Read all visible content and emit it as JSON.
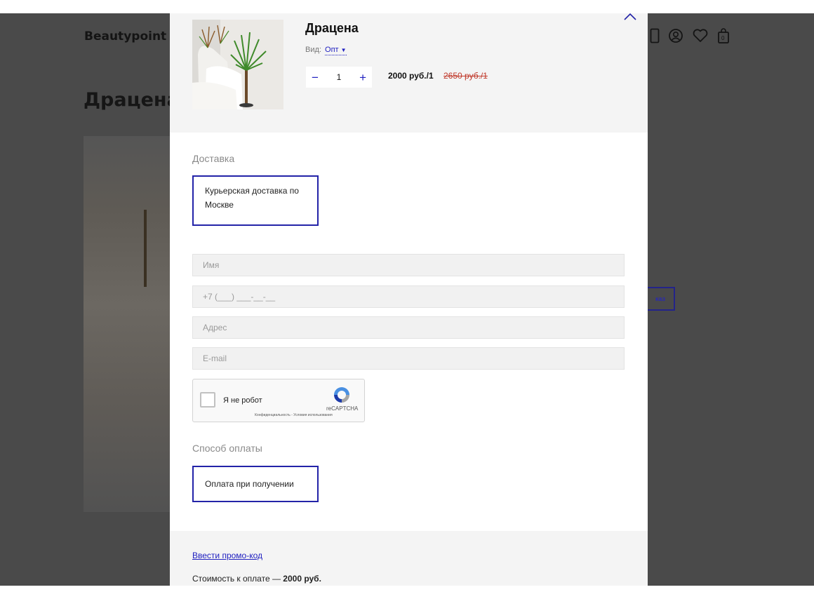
{
  "background": {
    "logo": "Beautypoint",
    "product_title": "Драцена",
    "order_button_fragment": "каз"
  },
  "modal": {
    "product": {
      "title": "Драцена",
      "variant_label": "Вид:",
      "variant_value": "Опт",
      "quantity": "1",
      "price": "2000 руб./1",
      "old_price": "2650 руб./1"
    },
    "delivery": {
      "label": "Доставка",
      "option": "Курьерская доставка по Москве"
    },
    "form": {
      "name_placeholder": "Имя",
      "phone_placeholder": "+7 (___) ___-__-__",
      "address_placeholder": "Адрес",
      "email_placeholder": "E-mail"
    },
    "captcha": {
      "label": "Я не робот",
      "brand": "reCAPTCHA",
      "links": "Конфиденциальность - Условия использования"
    },
    "payment": {
      "label": "Способ оплаты",
      "option": "Оплата при получении"
    },
    "footer": {
      "promo_link": "Ввести промо-код",
      "total_label": "Стоимость к оплате —",
      "total_value": "2000 руб."
    }
  },
  "colors": {
    "accent": "#2323a8",
    "overlay": "#4a4a4a",
    "old_price": "#c0392b"
  },
  "icons": [
    "close-icon",
    "phone-icon",
    "user-icon",
    "heart-icon",
    "cart-icon"
  ],
  "cart_count": "0"
}
